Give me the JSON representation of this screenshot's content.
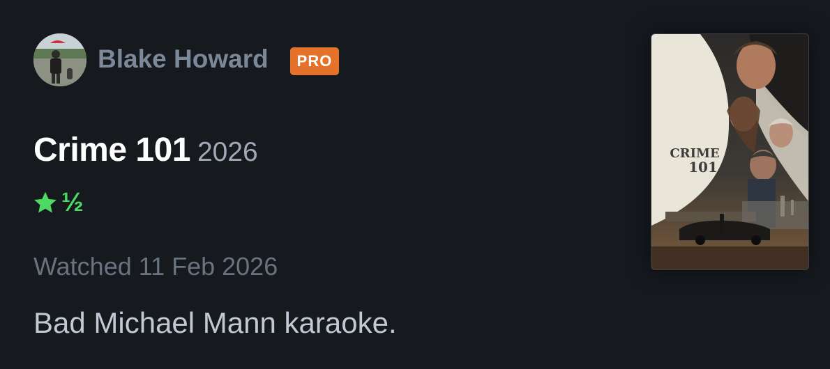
{
  "author": {
    "name": "Blake Howard",
    "badge": "PRO",
    "avatar_icon": "user-avatar-photo"
  },
  "film": {
    "title": "Crime 101",
    "year": "2026",
    "poster_title_line1": "CRIME",
    "poster_title_line2": "101"
  },
  "rating": {
    "stars": 1.5,
    "half_symbol": "½",
    "star_icon": "star-icon",
    "color": "#4cd964"
  },
  "watched_text": "Watched 11 Feb 2026",
  "review_text": "Bad Michael Mann karaoke.",
  "colors": {
    "background": "#16191e",
    "pro_badge": "#e5722a",
    "author_name": "#7b8898"
  }
}
